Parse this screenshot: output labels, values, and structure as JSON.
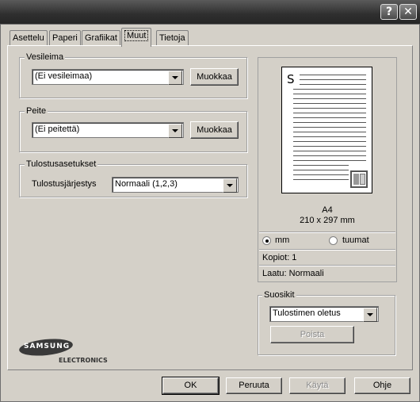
{
  "window": {
    "help_label": "?",
    "close_label": "✕"
  },
  "tabs": [
    {
      "label": "Asettelu"
    },
    {
      "label": "Paperi"
    },
    {
      "label": "Grafiikat"
    },
    {
      "label": "Muut",
      "active": true
    },
    {
      "label": "Tietoja"
    }
  ],
  "watermark": {
    "legend": "Vesileima",
    "value": "(Ei vesileimaa)",
    "edit_label": "Muokkaa"
  },
  "overlay": {
    "legend": "Peite",
    "value": "(Ei peitettä)",
    "edit_label": "Muokkaa"
  },
  "output": {
    "legend": "Tulostusasetukset",
    "order_label": "Tulostusjärjestys",
    "order_value": "Normaali (1,2,3)"
  },
  "preview": {
    "page_letter": "S",
    "paper_name": "A4",
    "paper_size": "210 x 297 mm",
    "unit_mm": "mm",
    "unit_inch": "tuumat",
    "selected_unit": "mm",
    "copies": "Kopiot: 1",
    "quality": "Laatu: Normaali"
  },
  "favorites": {
    "legend": "Suosikit",
    "value": "Tulostimen oletus",
    "delete_label": "Poista"
  },
  "logo": {
    "brand": "SAMSUNG",
    "sub": "ELECTRONICS"
  },
  "buttons": {
    "ok": "OK",
    "cancel": "Peruuta",
    "apply": "Käytä",
    "help": "Ohje"
  }
}
